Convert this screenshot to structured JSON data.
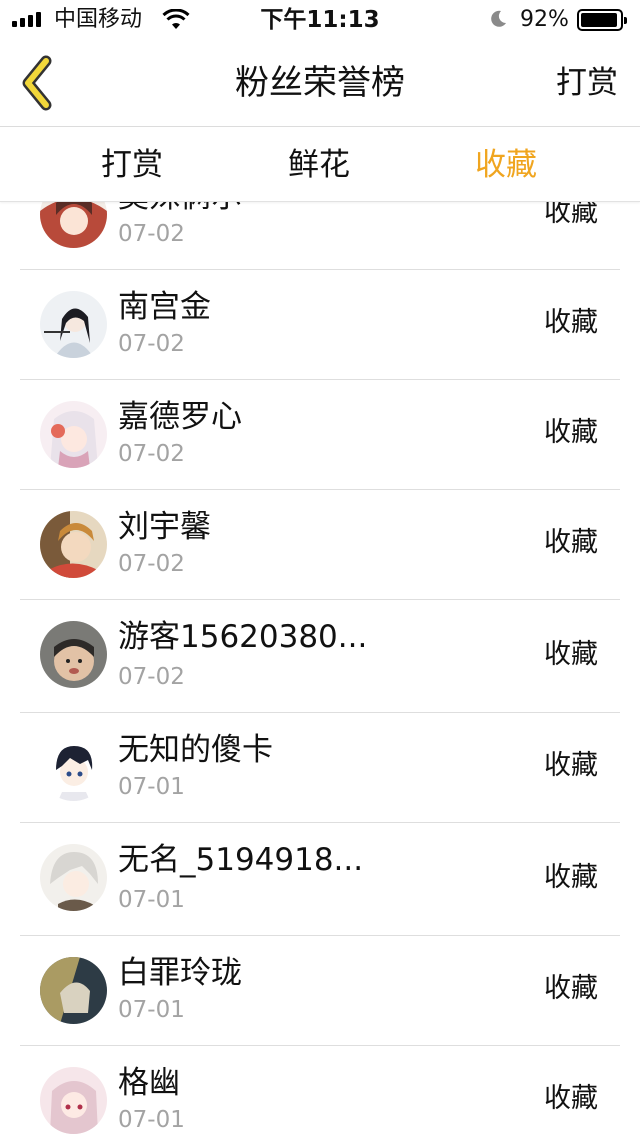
{
  "status_bar": {
    "carrier": "中国移动",
    "time": "下午11:13",
    "battery": "92%",
    "icons": [
      "signal-icon",
      "wifi-icon",
      "moon-icon",
      "battery-icon"
    ]
  },
  "nav": {
    "title": "粉丝荣誉榜",
    "right_label": "打赏",
    "back_icon": "chevron-left-icon",
    "accent": "#f0a51f"
  },
  "tabs": [
    {
      "label": "打赏",
      "active": false
    },
    {
      "label": "鲜花",
      "active": false
    },
    {
      "label": "收藏",
      "active": true
    }
  ],
  "list": [
    {
      "name": "莫殊俩尔",
      "date": "07-02",
      "action": "收藏"
    },
    {
      "name": "南宫金",
      "date": "07-02",
      "action": "收藏"
    },
    {
      "name": "嘉德罗心",
      "date": "07-02",
      "action": "收藏"
    },
    {
      "name": "刘宇馨",
      "date": "07-02",
      "action": "收藏"
    },
    {
      "name": "游客15620380...",
      "date": "07-02",
      "action": "收藏"
    },
    {
      "name": "无知的傻卡",
      "date": "07-01",
      "action": "收藏"
    },
    {
      "name": "无名_5194918...",
      "date": "07-01",
      "action": "收藏"
    },
    {
      "name": "白罪玲珑",
      "date": "07-01",
      "action": "收藏"
    },
    {
      "name": "格幽",
      "date": "07-01",
      "action": "收藏"
    }
  ]
}
